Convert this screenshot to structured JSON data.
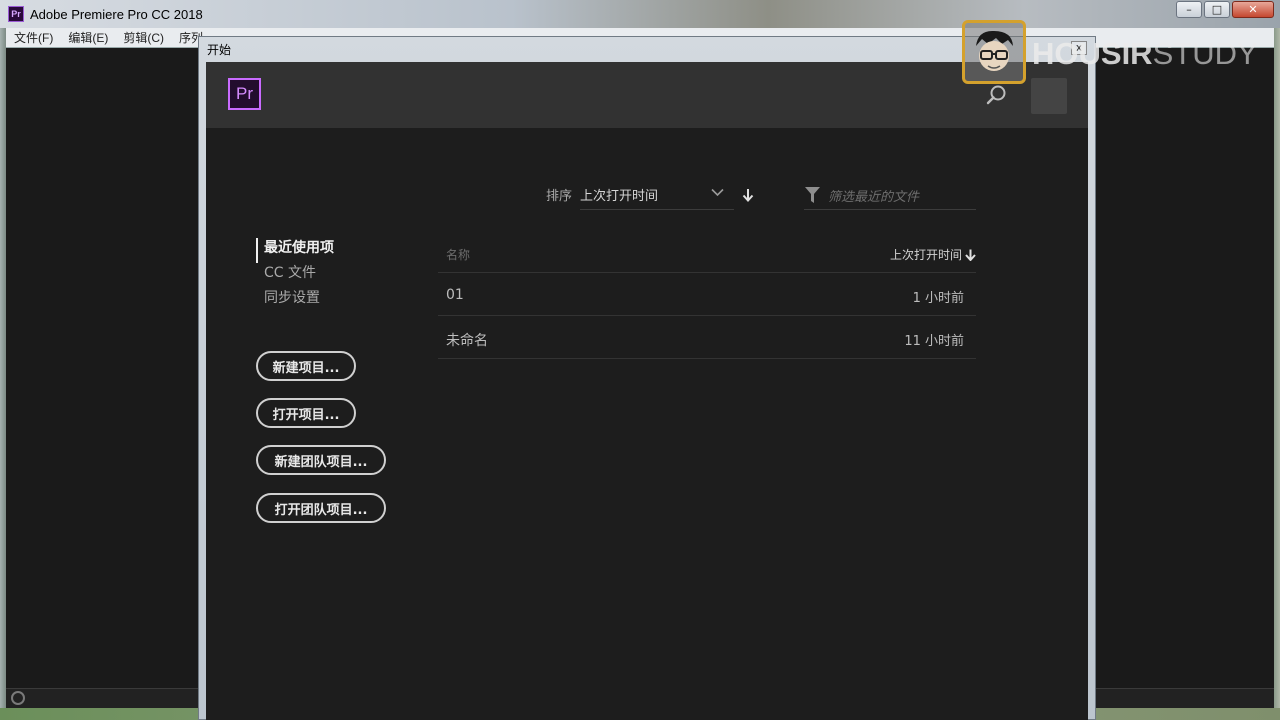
{
  "app": {
    "icon_label": "Pr",
    "title": "Adobe Premiere Pro CC 2018",
    "controls": [
      "–",
      "□",
      "✕"
    ]
  },
  "menu": [
    "文件(F)",
    "编辑(E)",
    "剪辑(C)",
    "序列"
  ],
  "dialog": {
    "title": "开始",
    "close": "x",
    "logo": "Pr",
    "sort": {
      "label": "排序",
      "value": "上次打开时间"
    },
    "filter": {
      "placeholder": "筛选最近的文件"
    },
    "nav": [
      "最近使用项",
      "CC 文件",
      "同步设置"
    ],
    "actions": [
      "新建项目...",
      "打开项目...",
      "新建团队项目...",
      "打开团队项目..."
    ],
    "list": {
      "col_name": "名称",
      "col_time": "上次打开时间",
      "rows": [
        {
          "name": "01",
          "time": "1 小时前"
        },
        {
          "name": "未命名",
          "time": "11 小时前"
        }
      ]
    }
  },
  "watermark": {
    "part1": "HOUSIR",
    "part2": "STUDY"
  },
  "colors": {
    "premiere_purple": "#c96bff",
    "dialog_bg": "#1d1d1d",
    "header_bg": "#323232"
  }
}
